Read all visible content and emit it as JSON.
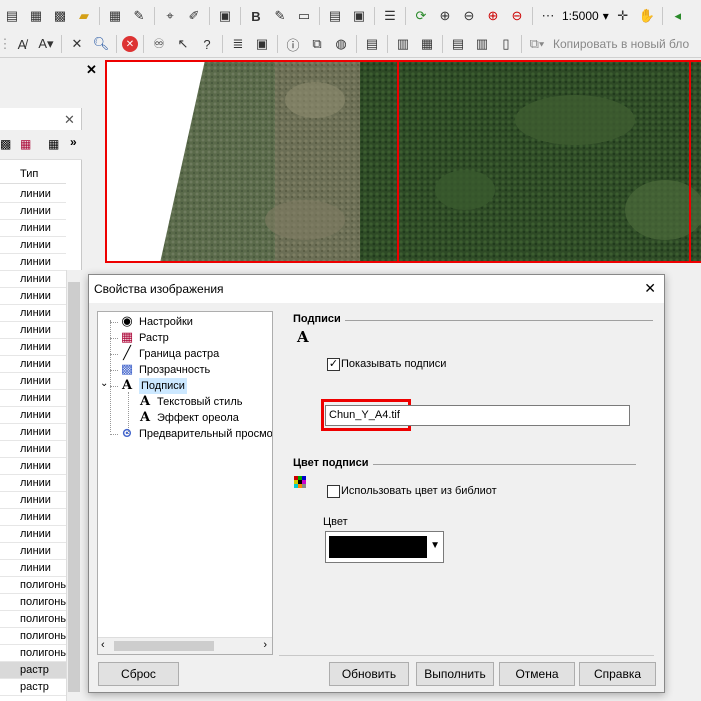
{
  "toolbar_top": {
    "zoom_scale": "1:5000",
    "icons": [
      "layer-icon",
      "layer-add-icon",
      "checker-icon",
      "folder-icon",
      "grid-icon",
      "edit-icon",
      "select-icon",
      "pen-icon",
      "save-icon",
      "bold-icon",
      "edit2-icon",
      "doc-icon",
      "doc2-icon",
      "doc3-icon",
      "list-icon",
      "refresh-icon",
      "zoom-in-icon",
      "zoom-out-icon",
      "zoom-in-red-icon",
      "zoom-out-red-icon",
      "scale-icon",
      "plus-icon",
      "hand-icon",
      "back-icon"
    ]
  },
  "toolbar_second": {
    "copy_label": "Копировать в новый бло"
  },
  "left_panel": {
    "column_header": "Тип",
    "rows": [
      "линии",
      "линии",
      "линии",
      "линии",
      "линии",
      "линии",
      "линии",
      "линии",
      "линии",
      "линии",
      "линии",
      "линии",
      "линии",
      "линии",
      "линии",
      "линии",
      "линии",
      "линии",
      "линии",
      "линии",
      "линии",
      "линии",
      "линии",
      "полигоны",
      "полигоны",
      "полигоны",
      "полигоны",
      "полигоны",
      "растр",
      "растр"
    ],
    "selected_row": 28
  },
  "dialog": {
    "title": "Свойства изображения",
    "tree": [
      {
        "label": "Настройки",
        "icon": "eye-icon",
        "level": 1
      },
      {
        "label": "Растр",
        "icon": "raster-icon",
        "level": 1
      },
      {
        "label": "Граница растра",
        "icon": "line-icon",
        "level": 1
      },
      {
        "label": "Прозрачность",
        "icon": "transparency-icon",
        "level": 1
      },
      {
        "label": "Подписи",
        "icon": "label-icon",
        "level": 1
      },
      {
        "label": "Текстовый стиль",
        "icon": "text-style-icon",
        "level": 2
      },
      {
        "label": "Эффект ореола",
        "icon": "halo-icon",
        "level": 2
      },
      {
        "label": "Предварительный просмо",
        "icon": "preview-icon",
        "level": 1
      }
    ],
    "section_labels_title": "Подписи",
    "show_labels_checkbox": "Показывать подписи",
    "show_labels_checked": true,
    "label_text_value": "Chun_Y_A4.tif",
    "section_color_title": "Цвет подписи",
    "use_library_color_checkbox": "Использовать цвет из библиот",
    "use_library_color_checked": false,
    "color_label": "Цвет",
    "color_value": "#000000",
    "buttons": {
      "reset": "Сброс",
      "update": "Обновить",
      "apply": "Выполнить",
      "cancel": "Отмена",
      "help": "Справка"
    },
    "close_glyph": "✕"
  },
  "colors": {
    "highlight_red": "#e00000",
    "selection_blue": "#cce8ff"
  }
}
